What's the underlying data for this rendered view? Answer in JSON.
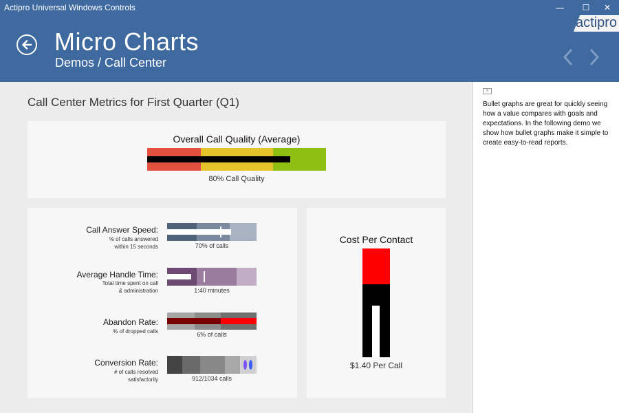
{
  "window": {
    "title": "Actipro Universal Windows Controls",
    "minimize_glyph": "—",
    "maximize_glyph": "☐",
    "close_glyph": "✕"
  },
  "header": {
    "title": "Micro Charts",
    "breadcrumb": "Demos / Call Center",
    "logo_text": "actipro",
    "back_icon": "back-arrow-icon",
    "prev_icon": "chevron-left-icon",
    "next_icon": "chevron-right-icon"
  },
  "main": {
    "section_title": "Call Center Metrics for First Quarter (Q1)",
    "overall": {
      "title": "Overall Call Quality (Average)",
      "caption": "80% Call Quality",
      "value_fraction": 0.8,
      "colors": {
        "poor": "#e0523f",
        "fair": "#e4c32b",
        "good": "#8ebe11"
      }
    },
    "metrics": [
      {
        "label": "Call Answer Speed:",
        "sub1": "% of calls answered",
        "sub2": "within 15 seconds",
        "caption": "70% of calls"
      },
      {
        "label": "Average Handle Time:",
        "sub1": "Total time spent on call",
        "sub2": "& administration",
        "caption": "1:40 minutes"
      },
      {
        "label": "Abandon Rate:",
        "sub1": "% of dropped calls",
        "sub2": "",
        "caption": "6% of calls"
      },
      {
        "label": "Conversion Rate:",
        "sub1": "# of calls resolved",
        "sub2": "satisfactorily",
        "caption": "912/1034 calls"
      }
    ],
    "cost": {
      "title": "Cost Per Contact",
      "caption": "$1.40 Per Call",
      "colors": {
        "top": "#ff0000",
        "bottom": "#000000",
        "marker": "#ffffff"
      }
    }
  },
  "info_panel": {
    "icon": "document-icon",
    "text": "Bullet graphs are great for quickly seeing how a value compares with goals and expectations. In the following demo we show how bullet graphs make it simple to create easy-to-read reports."
  }
}
